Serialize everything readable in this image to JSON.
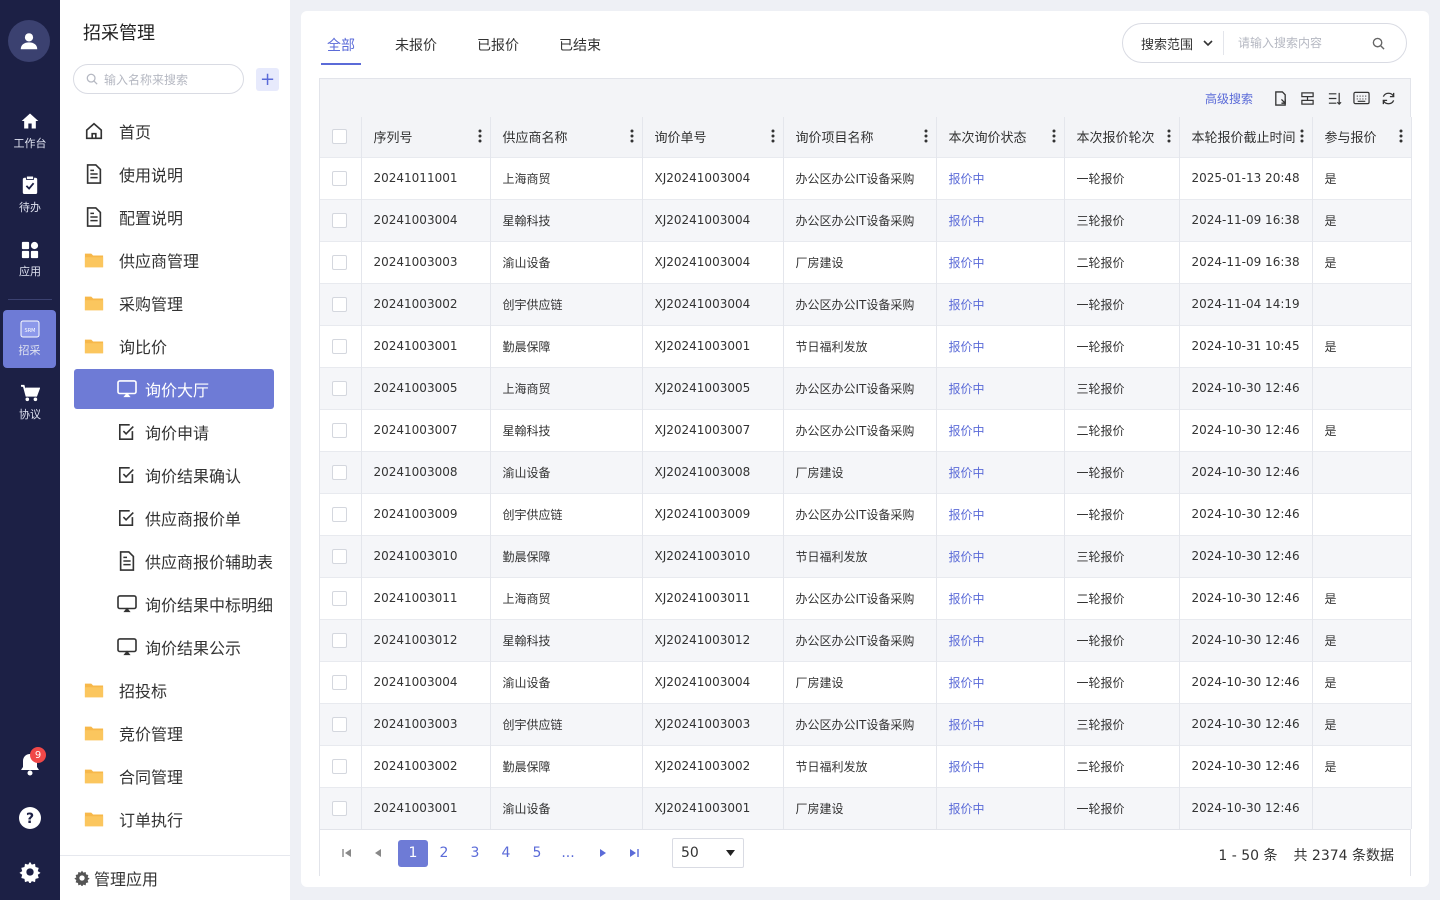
{
  "rail": {
    "items": [
      {
        "label": "工作台",
        "icon": "home-icon"
      },
      {
        "label": "待办",
        "icon": "clipboard-icon"
      },
      {
        "label": "应用",
        "icon": "apps-icon"
      },
      {
        "label": "招采",
        "icon": "srm-icon",
        "icon_text": "SRM"
      },
      {
        "label": "协议",
        "icon": "cart-icon"
      }
    ],
    "notification_count": "9"
  },
  "sidebar": {
    "title": "招采管理",
    "search_placeholder": "输入名称来搜索",
    "add_label": "+",
    "items": [
      {
        "label": "首页",
        "icon": "home-outline-icon",
        "level": 1
      },
      {
        "label": "使用说明",
        "icon": "document-icon",
        "level": 1
      },
      {
        "label": "配置说明",
        "icon": "document-icon",
        "level": 1
      },
      {
        "label": "供应商管理",
        "icon": "folder-icon",
        "level": 1
      },
      {
        "label": "采购管理",
        "icon": "folder-icon",
        "level": 1
      },
      {
        "label": "询比价",
        "icon": "folder-icon",
        "level": 1
      },
      {
        "label": "询价大厅",
        "icon": "monitor-icon",
        "level": 2,
        "active": true
      },
      {
        "label": "询价申请",
        "icon": "checkbox-icon",
        "level": 2
      },
      {
        "label": "询价结果确认",
        "icon": "checkbox-icon",
        "level": 2
      },
      {
        "label": "供应商报价单",
        "icon": "checkbox-icon",
        "level": 2
      },
      {
        "label": "供应商报价辅助表",
        "icon": "document-icon",
        "level": 2
      },
      {
        "label": "询价结果中标明细",
        "icon": "monitor-icon",
        "level": 2
      },
      {
        "label": "询价结果公示",
        "icon": "monitor-icon",
        "level": 2
      },
      {
        "label": "招投标",
        "icon": "folder-icon",
        "level": 1
      },
      {
        "label": "竞价管理",
        "icon": "folder-icon",
        "level": 1
      },
      {
        "label": "合同管理",
        "icon": "folder-icon",
        "level": 1
      },
      {
        "label": "订单执行",
        "icon": "folder-icon",
        "level": 1
      }
    ],
    "footer_label": "管理应用"
  },
  "tabs": [
    "全部",
    "未报价",
    "已报价",
    "已结束"
  ],
  "search": {
    "scope_label": "搜索范围",
    "placeholder": "请输入搜索内容"
  },
  "toolbar": {
    "advanced_search": "高级搜索"
  },
  "table": {
    "columns": [
      "序列号",
      "供应商名称",
      "询价单号",
      "询价项目名称",
      "本次询价状态",
      "本次报价轮次",
      "本轮报价截止时间",
      "参与报价"
    ],
    "rows": [
      [
        "20241011001",
        "上海商贸",
        "XJ20241003004",
        "办公区办公IT设备采购",
        "报价中",
        "一轮报价",
        "2025-01-13 20:48",
        "是"
      ],
      [
        "20241003004",
        "星翰科技",
        "XJ20241003004",
        "办公区办公IT设备采购",
        "报价中",
        "三轮报价",
        "2024-11-09 16:38",
        "是"
      ],
      [
        "20241003003",
        "渝山设备",
        "XJ20241003004",
        "厂房建设",
        "报价中",
        "二轮报价",
        "2024-11-09 16:38",
        "是"
      ],
      [
        "20241003002",
        "创宇供应链",
        "XJ20241003004",
        "办公区办公IT设备采购",
        "报价中",
        "一轮报价",
        "2024-11-04 14:19",
        ""
      ],
      [
        "20241003001",
        "勤晨保障",
        "XJ20241003001",
        "节日福利发放",
        "报价中",
        "一轮报价",
        "2024-10-31 10:45",
        "是"
      ],
      [
        "20241003005",
        "上海商贸",
        "XJ20241003005",
        "办公区办公IT设备采购",
        "报价中",
        "三轮报价",
        "2024-10-30 12:46",
        ""
      ],
      [
        "20241003007",
        "星翰科技",
        "XJ20241003007",
        "办公区办公IT设备采购",
        "报价中",
        "二轮报价",
        "2024-10-30 12:46",
        "是"
      ],
      [
        "20241003008",
        "渝山设备",
        "XJ20241003008",
        "厂房建设",
        "报价中",
        "一轮报价",
        "2024-10-30 12:46",
        ""
      ],
      [
        "20241003009",
        "创宇供应链",
        "XJ20241003009",
        "办公区办公IT设备采购",
        "报价中",
        "一轮报价",
        "2024-10-30 12:46",
        ""
      ],
      [
        "20241003010",
        "勤晨保障",
        "XJ20241003010",
        "节日福利发放",
        "报价中",
        "三轮报价",
        "2024-10-30 12:46",
        ""
      ],
      [
        "20241003011",
        "上海商贸",
        "XJ20241003011",
        "办公区办公IT设备采购",
        "报价中",
        "二轮报价",
        "2024-10-30 12:46",
        "是"
      ],
      [
        "20241003012",
        "星翰科技",
        "XJ20241003012",
        "办公区办公IT设备采购",
        "报价中",
        "一轮报价",
        "2024-10-30 12:46",
        "是"
      ],
      [
        "20241003004",
        "渝山设备",
        "XJ20241003004",
        "厂房建设",
        "报价中",
        "一轮报价",
        "2024-10-30 12:46",
        "是"
      ],
      [
        "20241003003",
        "创宇供应链",
        "XJ20241003003",
        "办公区办公IT设备采购",
        "报价中",
        "三轮报价",
        "2024-10-30 12:46",
        "是"
      ],
      [
        "20241003002",
        "勤晨保障",
        "XJ20241003002",
        "节日福利发放",
        "报价中",
        "二轮报价",
        "2024-10-30 12:46",
        "是"
      ],
      [
        "20241003001",
        "渝山设备",
        "XJ20241003001",
        "厂房建设",
        "报价中",
        "一轮报价",
        "2024-10-30 12:46",
        ""
      ]
    ]
  },
  "pager": {
    "pages": [
      "1",
      "2",
      "3",
      "4",
      "5",
      "..."
    ],
    "current": "1",
    "page_size": "50",
    "range": "1 - 50 条",
    "total": "共 2374 条数据"
  },
  "colors": {
    "accent": "#5b6bd8",
    "rail_bg": "#1c2045",
    "active_bg": "#6e7bd6",
    "badge": "#f04848"
  }
}
